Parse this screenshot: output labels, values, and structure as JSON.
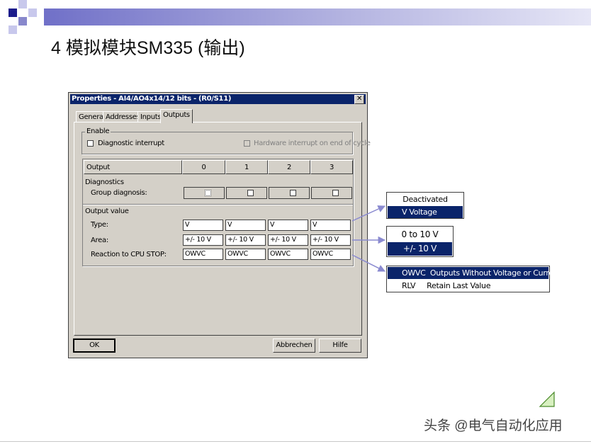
{
  "slide": {
    "title": "4  模拟模块SM335 (输出)",
    "watermark": "头条 @电气自动化应用"
  },
  "colors": {
    "titlebar": "#0a246a",
    "accent": "#7070c8",
    "dialog_bg": "#d4d0c8"
  },
  "dialog": {
    "title": "Properties - AI4/AO4x14/12 bits - (R0/S11)",
    "close_label": "✕",
    "tabs": [
      "General",
      "Addresses",
      "Inputs",
      "Outputs"
    ],
    "active_tab": "Outputs",
    "enable_group": {
      "label": "Enable",
      "diagnostic_interrupt": "Diagnostic interrupt",
      "hardware_interrupt": "Hardware interrupt on end of cycle"
    },
    "table": {
      "header_label": "Output",
      "columns": [
        "0",
        "1",
        "2",
        "3"
      ],
      "diagnostics_label": "Diagnostics",
      "group_diagnosis_label": "Group diagnosis:",
      "output_value_label": "Output value",
      "rows": [
        {
          "label": "Type:",
          "values": [
            "V",
            "V",
            "V",
            "V"
          ]
        },
        {
          "label": "Area:",
          "values": [
            "+/- 10 V",
            "+/- 10 V",
            "+/- 10 V",
            "+/- 10 V"
          ]
        },
        {
          "label": "Reaction to CPU STOP:",
          "values": [
            "OWVC",
            "OWVC",
            "OWVC",
            "OWVC"
          ]
        }
      ]
    },
    "buttons": {
      "ok": "OK",
      "cancel": "Abbrechen",
      "help": "Hilfe"
    }
  },
  "popups": {
    "type": {
      "items": [
        "Deactivated",
        "V  Voltage"
      ],
      "selected": 1
    },
    "area": {
      "items": [
        "0 to 10 V",
        "+/- 10 V"
      ],
      "selected": 1
    },
    "reaction": {
      "items": [
        "OWVC  Outputs Without Voltage or Current",
        "RLV     Retain Last Value"
      ],
      "selected": 0
    }
  }
}
